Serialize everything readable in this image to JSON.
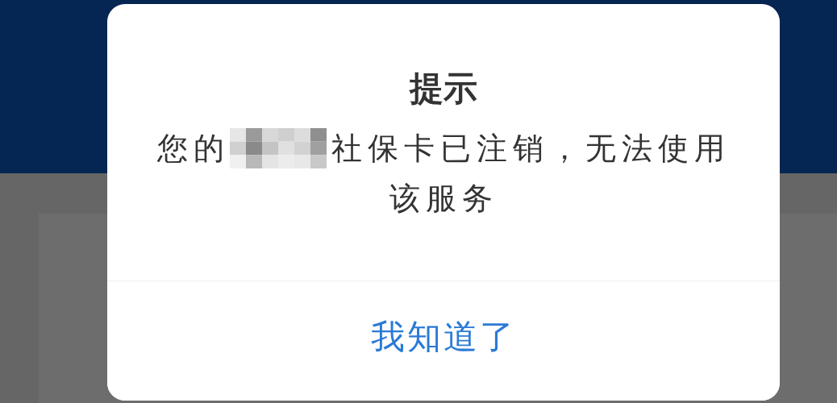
{
  "dialog": {
    "title": "提示",
    "message": {
      "before_redaction": "您的",
      "redacted": true,
      "after_redaction": "社保卡已注销，无法使用",
      "line_2": "该服务"
    },
    "buttons": [
      {
        "label": "我知道了"
      }
    ]
  }
}
